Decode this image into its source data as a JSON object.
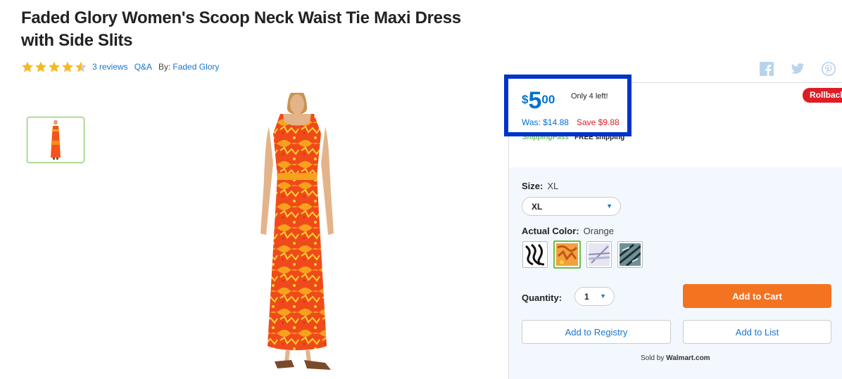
{
  "product": {
    "title": "Faded Glory Women's Scoop Neck Waist Tie Maxi Dress with Side Slits",
    "rating": 4.5,
    "reviews_label": "3 reviews",
    "qa_label": "Q&A",
    "by_label": "By:",
    "brand": "Faded Glory"
  },
  "share": {
    "icons": [
      "facebook-icon",
      "twitter-icon",
      "pinterest-icon"
    ]
  },
  "pricing": {
    "currency": "$",
    "dollars": "5",
    "cents": "00",
    "stock": "Only 4 left!",
    "was": "Was: $14.88",
    "save": "Save $9.88",
    "badge": "Rollback",
    "ship_pass": "ShippingPass",
    "free_shipping": "FREE shipping"
  },
  "options": {
    "size_label": "Size:",
    "size_value": "XL",
    "size_selected": "XL",
    "color_label": "Actual Color:",
    "color_value": "Orange",
    "quantity_label": "Quantity:",
    "quantity_value": "1"
  },
  "actions": {
    "add_to_cart": "Add to Cart",
    "add_to_registry": "Add to Registry",
    "add_to_list": "Add to List"
  },
  "seller": {
    "sold_by": "Sold by",
    "name": "Walmart.com"
  },
  "colors": {
    "accent": "#0071ce",
    "cart": "#f47321",
    "rollback": "#de1c24",
    "highlight_border": "#0033cc",
    "selected_swatch": "#6fbe44",
    "panel_bg": "#f2f8fd",
    "star": "#f8b81f"
  }
}
